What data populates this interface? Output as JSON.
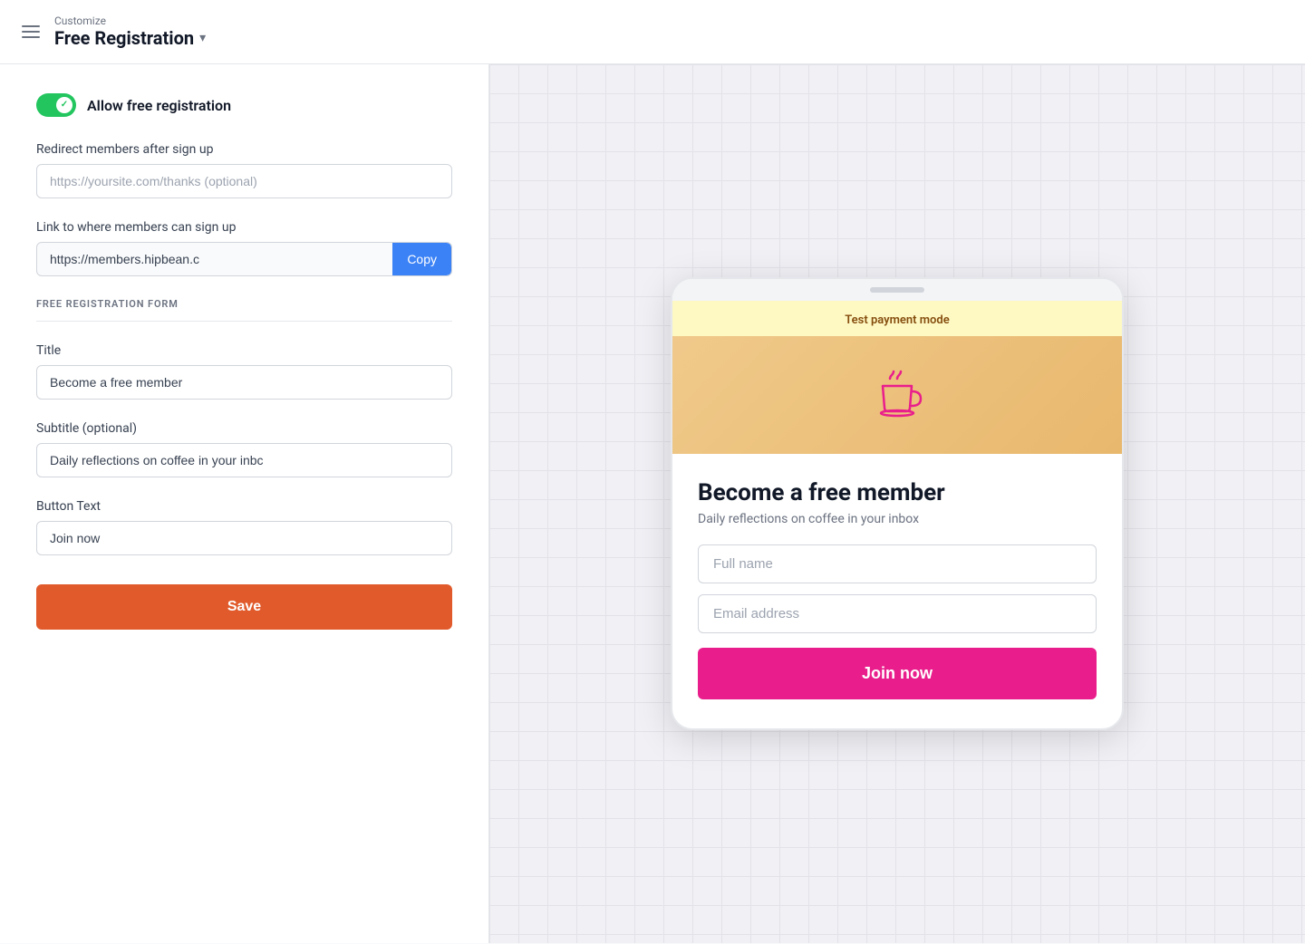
{
  "header": {
    "customize_label": "Customize",
    "title": "Free Registration",
    "chevron": "▾"
  },
  "left_panel": {
    "toggle_label": "Allow free registration",
    "toggle_checked": true,
    "redirect_label": "Redirect members after sign up",
    "redirect_placeholder": "https://yoursite.com/thanks (optional)",
    "redirect_value": "",
    "link_label": "Link to where members can sign up",
    "link_value": "https://members.hipbean.c",
    "copy_button_label": "Copy",
    "section_header": "FREE REGISTRATION FORM",
    "title_label": "Title",
    "title_value": "Become a free member",
    "subtitle_label": "Subtitle (optional)",
    "subtitle_value": "Daily reflections on coffee in your inbc",
    "button_text_label": "Button Text",
    "button_text_value": "Join now",
    "save_button_label": "Save"
  },
  "right_panel": {
    "test_payment_text": "Test payment mode",
    "preview_title": "Become a free member",
    "preview_subtitle": "Daily reflections on coffee in your inbox",
    "full_name_placeholder": "Full name",
    "email_placeholder": "Email address",
    "join_button_label": "Join now"
  }
}
